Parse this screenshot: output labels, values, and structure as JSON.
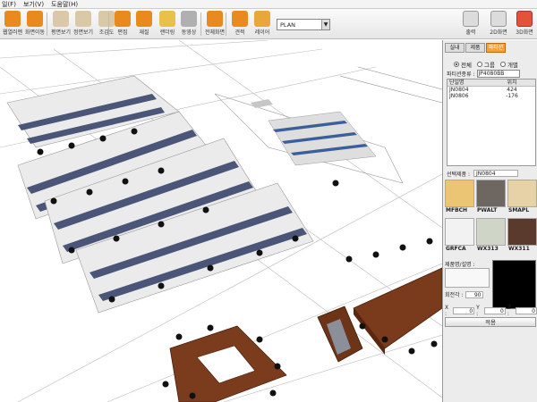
{
  "menubar": {
    "items": [
      "일(F)",
      "보기(V)",
      "도움말(H)"
    ]
  },
  "toolbar": {
    "buttons": [
      {
        "label": "웹열러멘",
        "icon": "folder-icon",
        "color": "#e98a1e"
      },
      {
        "label": "화면이동",
        "icon": "hand-icon",
        "color": "#e98a1e"
      },
      {
        "label": "평면보기",
        "icon": "plan-view-icon",
        "color": "#d9c9a8"
      },
      {
        "label": "정면보기",
        "icon": "front-view-icon",
        "color": "#d9c9a8"
      },
      {
        "label": "조감도",
        "icon": "bird-eye-icon",
        "color": "#d9c9a8"
      },
      {
        "label": "편집",
        "icon": "edit-icon",
        "color": "#e98a1e"
      },
      {
        "label": "재질",
        "icon": "material-icon",
        "color": "#e98a1e"
      },
      {
        "label": "랜더링",
        "icon": "render-icon",
        "color": "#e9c14a"
      },
      {
        "label": "동영상",
        "icon": "video-icon",
        "color": "#b0b0b0"
      },
      {
        "label": "전체화면",
        "icon": "fullscreen-icon",
        "color": "#e98a1e"
      },
      {
        "label": "견적",
        "icon": "estimate-icon",
        "color": "#e98a1e"
      },
      {
        "label": "레이어",
        "icon": "layer-icon",
        "color": "#e9a63a"
      }
    ],
    "right_buttons": [
      {
        "label": "출력",
        "icon": "print-icon"
      },
      {
        "label": "2D화면",
        "icon": "2d-view-icon"
      },
      {
        "label": "3D화면",
        "icon": "3d-view-icon"
      }
    ],
    "view_select": "PLAN"
  },
  "panel": {
    "tabs": [
      "실내",
      "제품",
      "파티션"
    ],
    "active_tab": 2,
    "radios": [
      "전체",
      "그룹",
      "개별"
    ],
    "selected_radio": 0,
    "kind_label": "파티션종류 :",
    "kind_value": "JP4080BB",
    "list_headers": [
      "단일명",
      "위치"
    ],
    "list_rows": [
      {
        "name": "JN0804",
        "pos": "424"
      },
      {
        "name": "JN0806",
        "pos": "-176"
      }
    ],
    "selected_label": "선택제품 :",
    "selected_value": "JN0804",
    "swatches": [
      {
        "name": "MFBCH",
        "color": "#ecc574"
      },
      {
        "name": "PWALT",
        "color": "#6e6660"
      },
      {
        "name": "SMAPL",
        "color": "#e7d2a8"
      },
      {
        "name": "GRFCA",
        "color": "#f2f2f2"
      },
      {
        "name": "WX313",
        "color": "#cfd5c7"
      },
      {
        "name": "WX311",
        "color": "#5a3a2c"
      }
    ],
    "desc_label": "제품명/설명 :",
    "rotation_label": "회전각 :",
    "rotation_value": "90",
    "x_label": "X :",
    "x_value": "0",
    "y_label": "Y :",
    "y_value": "0",
    "z_label": "Z :",
    "z_value": "0",
    "apply_label": "적용"
  }
}
